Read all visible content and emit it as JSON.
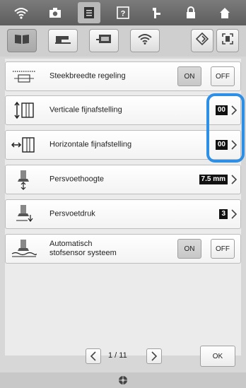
{
  "topbar": {
    "icons": [
      "wifi-icon",
      "camera-icon",
      "document-icon",
      "help-icon",
      "needle-threading-icon",
      "lock-icon",
      "home-icon"
    ],
    "active_index": 2
  },
  "tabs": {
    "icons": [
      "book-icon",
      "sewing-machine-icon",
      "embroidery-icon",
      "wifi-icon",
      "settings-diamond-icon",
      "scan-frame-icon"
    ],
    "selected_index": 0
  },
  "settings": [
    {
      "label": "Steekbreedte regeling",
      "type": "toggle",
      "on_label": "ON",
      "off_label": "OFF",
      "selected": "ON"
    },
    {
      "label": "Verticale fijnafstelling",
      "type": "value",
      "value": "00"
    },
    {
      "label": "Horizontale fijnafstelling",
      "type": "value",
      "value": "00"
    },
    {
      "label": "Persvoethoogte",
      "type": "value",
      "value": "7.5 mm"
    },
    {
      "label": "Persvoetdruk",
      "type": "value",
      "value": "3"
    },
    {
      "label_line1": "Automatisch",
      "label_line2": "stofsensor systeem",
      "type": "toggle",
      "on_label": "ON",
      "off_label": "OFF",
      "selected": "ON"
    }
  ],
  "pager": {
    "label": "1 / 11"
  },
  "ok_label": "OK",
  "colors": {
    "highlight": "#2d8fe5",
    "value_bg": "#111111"
  }
}
